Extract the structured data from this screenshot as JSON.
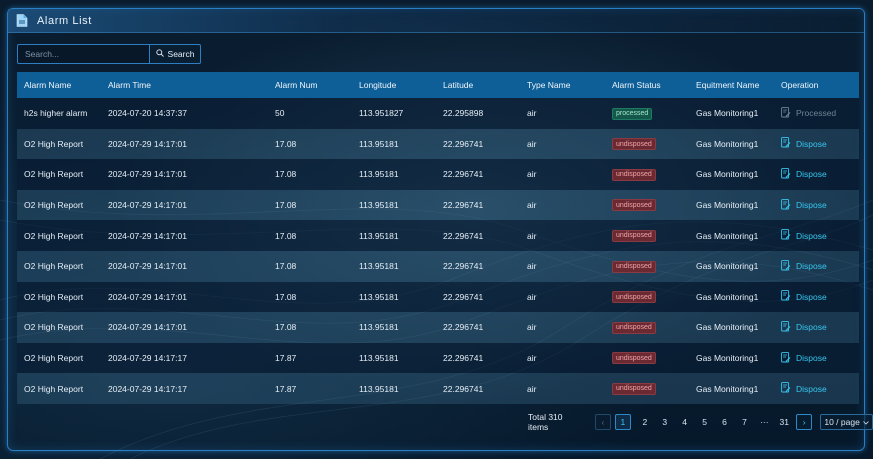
{
  "window": {
    "title": "Alarm List"
  },
  "search": {
    "placeholder": "Search...",
    "button_label": "Search"
  },
  "table": {
    "columns": [
      "Alarm Name",
      "Alarm Time",
      "Alarm Num",
      "Longitude",
      "Latitude",
      "Type Name",
      "Alarm Status",
      "Equitment Name",
      "Operation"
    ],
    "rows": [
      {
        "name": "h2s higher alarm",
        "time": "2024-07-20 14:37:37",
        "num": "50",
        "lon": "113.951827",
        "lat": "22.295898",
        "type": "air",
        "status": "processed",
        "equipment": "Gas Monitoring1",
        "operation": "Processed"
      },
      {
        "name": "O2 High Report",
        "time": "2024-07-29 14:17:01",
        "num": "17.08",
        "lon": "113.95181",
        "lat": "22.296741",
        "type": "air",
        "status": "undisposed",
        "equipment": "Gas Monitoring1",
        "operation": "Dispose"
      },
      {
        "name": "O2 High Report",
        "time": "2024-07-29 14:17:01",
        "num": "17.08",
        "lon": "113.95181",
        "lat": "22.296741",
        "type": "air",
        "status": "undisposed",
        "equipment": "Gas Monitoring1",
        "operation": "Dispose"
      },
      {
        "name": "O2 High Report",
        "time": "2024-07-29 14:17:01",
        "num": "17.08",
        "lon": "113.95181",
        "lat": "22.296741",
        "type": "air",
        "status": "undisposed",
        "equipment": "Gas Monitoring1",
        "operation": "Dispose"
      },
      {
        "name": "O2 High Report",
        "time": "2024-07-29 14:17:01",
        "num": "17.08",
        "lon": "113.95181",
        "lat": "22.296741",
        "type": "air",
        "status": "undisposed",
        "equipment": "Gas Monitoring1",
        "operation": "Dispose"
      },
      {
        "name": "O2 High Report",
        "time": "2024-07-29 14:17:01",
        "num": "17.08",
        "lon": "113.95181",
        "lat": "22.296741",
        "type": "air",
        "status": "undisposed",
        "equipment": "Gas Monitoring1",
        "operation": "Dispose"
      },
      {
        "name": "O2 High Report",
        "time": "2024-07-29 14:17:01",
        "num": "17.08",
        "lon": "113.95181",
        "lat": "22.296741",
        "type": "air",
        "status": "undisposed",
        "equipment": "Gas Monitoring1",
        "operation": "Dispose"
      },
      {
        "name": "O2 High Report",
        "time": "2024-07-29 14:17:01",
        "num": "17.08",
        "lon": "113.95181",
        "lat": "22.296741",
        "type": "air",
        "status": "undisposed",
        "equipment": "Gas Monitoring1",
        "operation": "Dispose"
      },
      {
        "name": "O2 High Report",
        "time": "2024-07-29 14:17:17",
        "num": "17.87",
        "lon": "113.95181",
        "lat": "22.296741",
        "type": "air",
        "status": "undisposed",
        "equipment": "Gas Monitoring1",
        "operation": "Dispose"
      },
      {
        "name": "O2 High Report",
        "time": "2024-07-29 14:17:17",
        "num": "17.87",
        "lon": "113.95181",
        "lat": "22.296741",
        "type": "air",
        "status": "undisposed",
        "equipment": "Gas Monitoring1",
        "operation": "Dispose"
      }
    ]
  },
  "pagination": {
    "total_label": "Total 310 items",
    "current_page": "1",
    "pages": [
      "2",
      "3",
      "4",
      "5",
      "6",
      "7"
    ],
    "ellipsis": "···",
    "last_page": "31",
    "page_size_label": "10 / page"
  },
  "colors": {
    "accent": "#37c7ef",
    "header_bg": "#0e5e97",
    "processed_bg": "#15574a",
    "undisposed_bg": "#6b2a32",
    "frame": "#2a7fc4"
  }
}
